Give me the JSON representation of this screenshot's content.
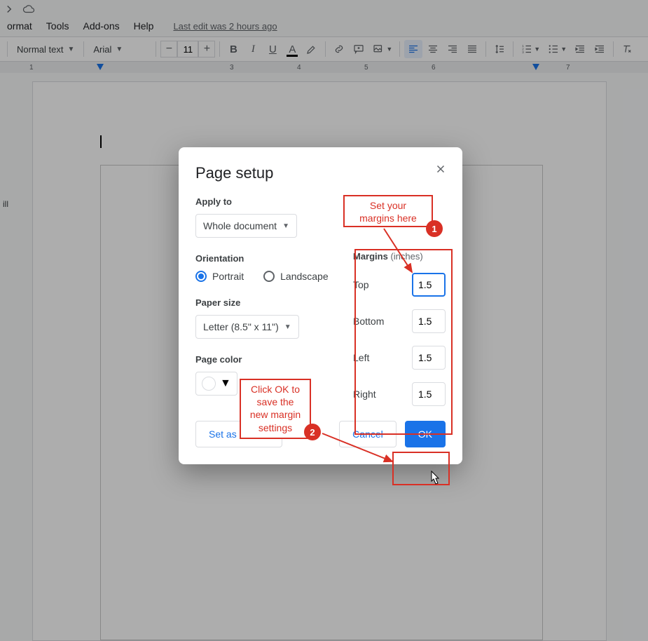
{
  "menu": {
    "format": "ormat",
    "tools": "Tools",
    "addons": "Add-ons",
    "help": "Help",
    "edit_info": "Last edit was 2 hours ago"
  },
  "side_text": "ill",
  "toolbar": {
    "style_label": "Normal text",
    "font_label": "Arial",
    "font_size": "11"
  },
  "ruler": {
    "t1": "1",
    "t3": "3",
    "t4": "4",
    "t5": "5",
    "t6": "6",
    "t7": "7"
  },
  "dialog": {
    "title": "Page setup",
    "apply_to_label": "Apply to",
    "apply_to_value": "Whole document",
    "orientation_label": "Orientation",
    "portrait": "Portrait",
    "landscape": "Landscape",
    "paper_size_label": "Paper size",
    "paper_size_value": "Letter (8.5\" x 11\")",
    "page_color_label": "Page color",
    "margins_label": "Margins",
    "margins_unit": " (inches)",
    "margins": {
      "top_label": "Top",
      "top": "1.5",
      "bottom_label": "Bottom",
      "bottom": "1.5",
      "left_label": "Left",
      "left": "1.5",
      "right_label": "Right",
      "right": "1.5"
    },
    "set_default": "Set as default",
    "cancel": "Cancel",
    "ok": "OK"
  },
  "annotations": {
    "a1_line1": "Set your",
    "a1_line2": "margins here",
    "badge1": "1",
    "a2_line1": "Click OK to",
    "a2_line2": "save the",
    "a2_line3": "new margin",
    "a2_line4": "settings",
    "badge2": "2"
  }
}
